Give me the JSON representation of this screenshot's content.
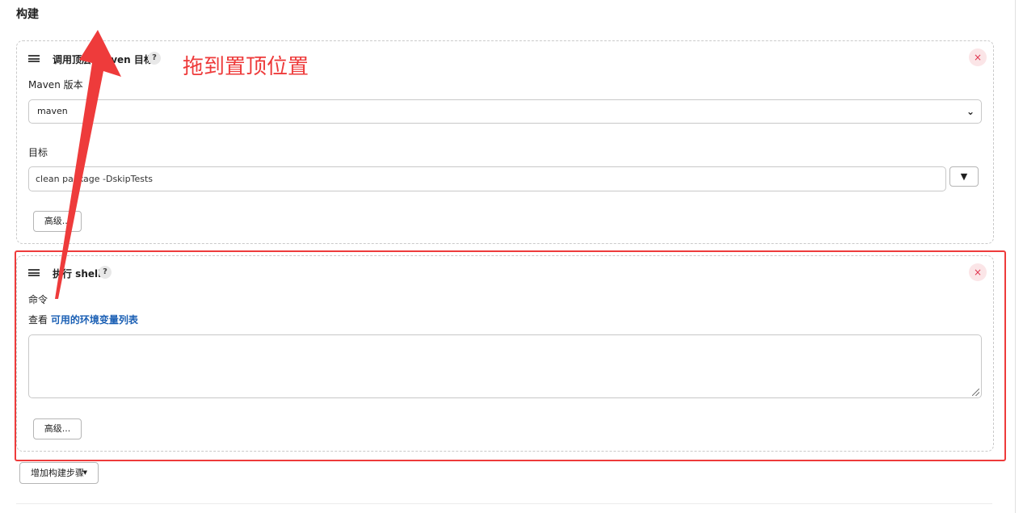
{
  "section": {
    "title": "构建"
  },
  "maven_step": {
    "title": "调用顶层 Maven 目标",
    "help": "?",
    "close": "×",
    "version_label": "Maven 版本",
    "version_value": "maven",
    "goals_label": "目标",
    "goals_value": "clean package -DskipTests",
    "expand": "▼",
    "advanced": "高级..."
  },
  "shell_step": {
    "title": "执行 shell",
    "help": "?",
    "close": "×",
    "command_label": "命令",
    "env_prefix": "查看 ",
    "env_link": "可用的环境变量列表",
    "command_value": "",
    "advanced": "高级..."
  },
  "add_step": {
    "label": "增加构建步骤",
    "caret": "▼"
  },
  "annotation": {
    "text": "拖到置顶位置",
    "color": "#ee3b3b"
  },
  "icons": {
    "drag": "drag-handle-icon",
    "help": "question-icon",
    "close": "close-icon",
    "chevron": "chevron-down-icon",
    "caret": "caret-down-icon",
    "resize": "resize-grip-icon"
  },
  "colors": {
    "link": "#1a5fb4",
    "close_bg": "#fbe5e7",
    "close_fg": "#e0334d",
    "highlight": "#ee3b3b"
  }
}
